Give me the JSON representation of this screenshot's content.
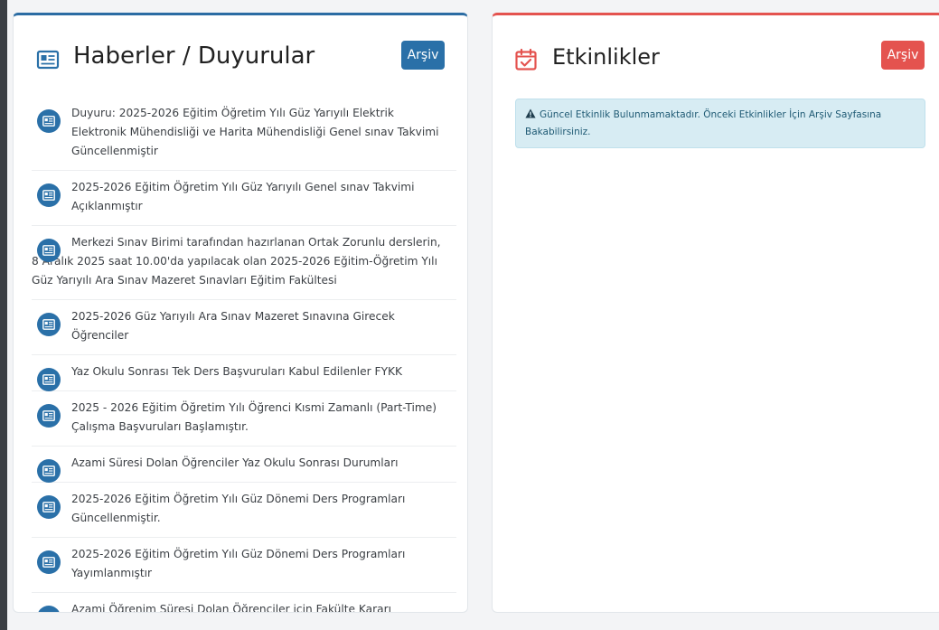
{
  "news": {
    "title": "Haberler / Duyurular",
    "archive_label": "Arşiv",
    "accent": "#2a70a8",
    "icon": "newspaper-icon",
    "items": [
      {
        "text": "Duyuru: 2025-2026 Eğitim Öğretim Yılı Güz Yarıyılı Elektrik Elektronik Mühendisliği ve Harita Mühendisliği Genel sınav Takvimi Güncellenmiştir"
      },
      {
        "text": "2025-2026 Eğitim Öğretim Yılı Güz Yarıyılı Genel sınav Takvimi Açıklanmıştır"
      },
      {
        "text": "Merkezi Sınav Birimi tarafından hazırlanan Ortak Zorunlu derslerin, 8 Aralık 2025 saat 10.00'da yapılacak olan 2025-2026 Eğitim-Öğretim Yılı Güz Yarıyılı Ara Sınav Mazeret Sınavları Eğitim Fakültesi"
      },
      {
        "text": "2025-2026 Güz Yarıyılı Ara Sınav Mazeret Sınavına Girecek Öğrenciler"
      },
      {
        "text": "Yaz Okulu Sonrası Tek Ders Başvuruları Kabul Edilenler FYKK"
      },
      {
        "text": "2025 - 2026 Eğitim Öğretim Yılı Öğrenci Kısmi Zamanlı (Part-Time) Çalışma Başvuruları Başlamıştır."
      },
      {
        "text": "Azami Süresi Dolan Öğrenciler Yaz Okulu Sonrası Durumları"
      },
      {
        "text": "2025-2026 Eğitim Öğretim Yılı Güz Dönemi Ders Programları Güncellenmiştir."
      },
      {
        "text": "2025-2026 Eğitim Öğretim Yılı Güz Dönemi Ders Programları Yayımlanmıştır"
      },
      {
        "text": "Azami Öğrenim Süresi Dolan Öğrenciler için Fakülte Kararı"
      }
    ]
  },
  "events": {
    "title": "Etkinlikler",
    "archive_label": "Arşiv",
    "accent": "#e4534f",
    "icon": "calendar-check-icon",
    "alert_text": "Güncel Etkinlik Bulunmamaktadır. Önceki Etkinlikler İçin Arşiv Sayfasına Bakabilirsiniz.",
    "alert_icon": "warning-icon"
  }
}
